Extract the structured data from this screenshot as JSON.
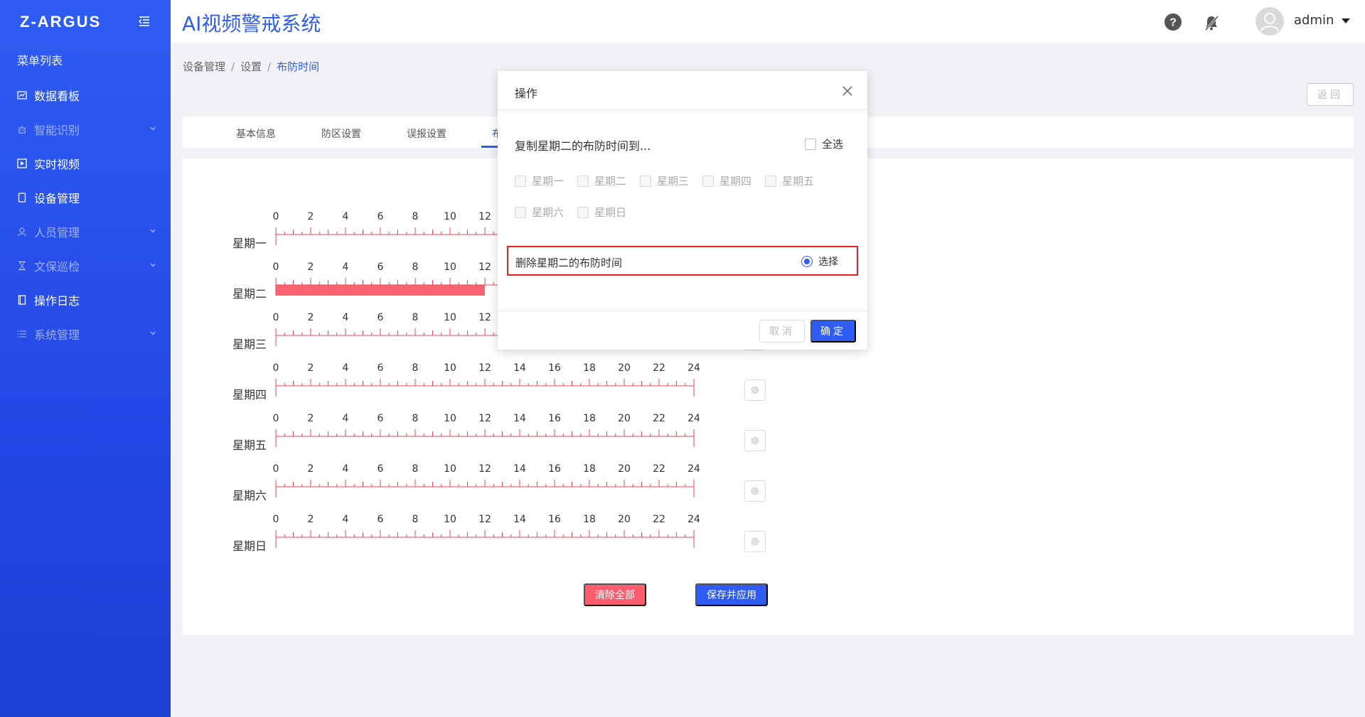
{
  "sidebar": {
    "logo": "Z-ARGUS",
    "menu_title": "菜单列表",
    "items": [
      {
        "label": "数据看板",
        "icon": "chart-line-icon",
        "dim": false,
        "expandable": false
      },
      {
        "label": "智能识别",
        "icon": "robot-icon",
        "dim": true,
        "expandable": true
      },
      {
        "label": "实时视频",
        "icon": "video-play-icon",
        "dim": false,
        "expandable": false
      },
      {
        "label": "设备管理",
        "icon": "device-icon",
        "dim": false,
        "expandable": false
      },
      {
        "label": "人员管理",
        "icon": "user-icon",
        "dim": true,
        "expandable": true
      },
      {
        "label": "文保巡检",
        "icon": "hourglass-icon",
        "dim": true,
        "expandable": true
      },
      {
        "label": "操作日志",
        "icon": "document-icon",
        "dim": false,
        "expandable": false
      },
      {
        "label": "系统管理",
        "icon": "list-icon",
        "dim": true,
        "expandable": true
      }
    ]
  },
  "header": {
    "title": "AI视频警戒系统",
    "username": "admin"
  },
  "breadcrumb": {
    "items": [
      "设备管理",
      "设置"
    ],
    "current": "布防时间",
    "separator": "/"
  },
  "back_label": "返回",
  "tabs": [
    {
      "label": "基本信息",
      "active": false
    },
    {
      "label": "防区设置",
      "active": false
    },
    {
      "label": "误报设置",
      "active": false
    },
    {
      "label": "布",
      "active": true
    }
  ],
  "schedule": {
    "tick_labels": [
      "0",
      "2",
      "4",
      "6",
      "8",
      "10",
      "12",
      "14",
      "16",
      "18",
      "20",
      "22",
      "24"
    ],
    "days": [
      {
        "label": "星期一",
        "armed": []
      },
      {
        "label": "星期二",
        "armed": [
          [
            0,
            12
          ]
        ]
      },
      {
        "label": "星期三",
        "armed": []
      },
      {
        "label": "星期四",
        "armed": []
      },
      {
        "label": "星期五",
        "armed": []
      },
      {
        "label": "星期六",
        "armed": []
      },
      {
        "label": "星期日",
        "armed": []
      }
    ],
    "armed_color": "#fe6470",
    "ruler_color": "#e8445a"
  },
  "actions": {
    "clear_all": "清除全部",
    "save_apply": "保存并应用"
  },
  "modal": {
    "title": "操作",
    "copy_label": "复制星期二的布防时间到...",
    "select_all": "全选",
    "days": [
      "星期一",
      "星期二",
      "星期三",
      "星期四",
      "星期五",
      "星期六",
      "星期日"
    ],
    "delete_label": "删除星期二的布防时间",
    "radio_label": "选择",
    "cancel": "取消",
    "ok": "确定"
  }
}
